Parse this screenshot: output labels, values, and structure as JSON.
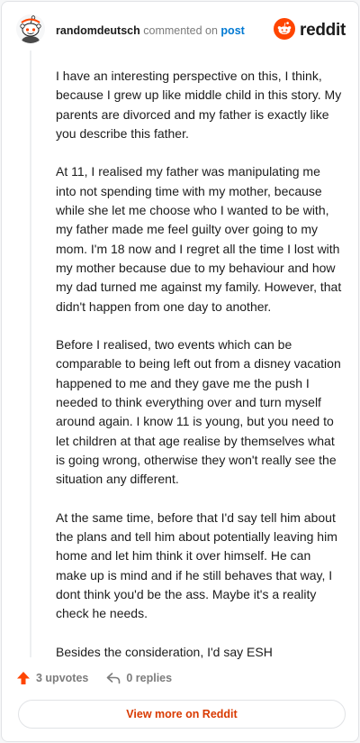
{
  "header": {
    "username": "randomdeutsch",
    "commented_text": "commented on",
    "post_link": "post",
    "brand": "reddit"
  },
  "comment": {
    "paragraphs": [
      "I have an interesting perspective on this, I think, because I grew up like middle child in this story. My parents are divorced and my father is exactly like you describe this father.",
      "At 11, I realised my father was manipulating me into not spending time with my mother, because while she let me choose who I wanted to be with, my father made me feel guilty over going to my mom. I'm 18 now and I regret all the time I lost with my mother because due to my behaviour and how my dad turned me against my family. However, that didn't happen from one day to another.",
      "Before I realised, two events which can be comparable to being left out from a disney vacation happened to me and they gave me the push I needed to think everything over and turn myself around again. I know 11 is young, but you need to let children at that age realise by themselves what is going wrong, otherwise they won't really see the situation any different.",
      "At the same time, before that I'd say tell him about the plans and tell him about potentially leaving him home and let him think it over himself. He can make up is mind and if he still behaves that way, I dont think you'd be the ass. Maybe it's a reality check he needs.",
      "Besides the consideration, I'd say ESH"
    ]
  },
  "actions": {
    "upvotes": "3 upvotes",
    "replies": "0 replies"
  },
  "footer": {
    "view_more": "View more on Reddit"
  },
  "colors": {
    "accent_orange": "#ff4500",
    "link_blue": "#0079d3",
    "button_text": "#d93a00"
  },
  "icons": {
    "avatar": "snoo-avatar-icon",
    "brand": "reddit-logo-icon",
    "upvote": "upvote-arrow-icon",
    "reply": "reply-arrow-icon"
  }
}
